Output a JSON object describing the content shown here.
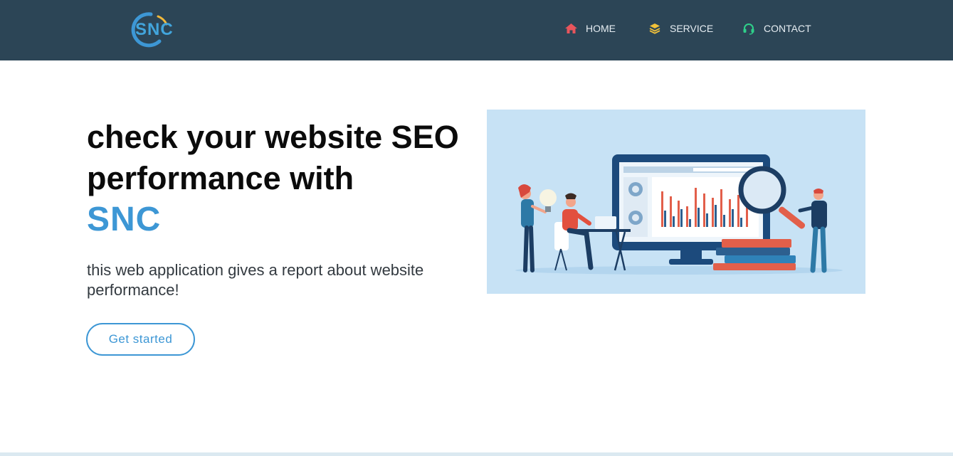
{
  "header": {
    "logo_text": "SNC",
    "nav": [
      {
        "label": "HOME",
        "icon": "home-icon",
        "icon_color": "#e8555c"
      },
      {
        "label": "SERVICE",
        "icon": "layers-icon",
        "icon_color": "#f2c23a"
      },
      {
        "label": "CONTACT",
        "icon": "headset-icon",
        "icon_color": "#2fd08a"
      }
    ]
  },
  "hero": {
    "title": "check your website SEO performance with",
    "brand": "SNC",
    "subtitle": "this web application gives a report about website performance!",
    "cta_label": "Get started"
  },
  "colors": {
    "navbar_bg": "#2c4556",
    "accent": "#3d97d5",
    "illustration_bg": "#c7e2f5"
  }
}
